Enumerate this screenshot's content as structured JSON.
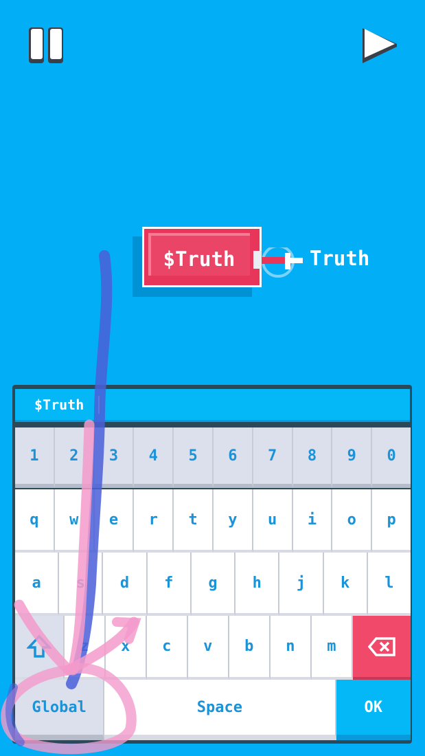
{
  "toolbar": {
    "pause_icon": "pause-icon",
    "play_icon": "play-icon"
  },
  "canvas": {
    "variable_block_label": "$Truth",
    "linked_label": "Truth"
  },
  "keyboard": {
    "input_value": "$Truth",
    "row_numbers": [
      "1",
      "2",
      "3",
      "4",
      "5",
      "6",
      "7",
      "8",
      "9",
      "0"
    ],
    "row_top": [
      "q",
      "w",
      "e",
      "r",
      "t",
      "y",
      "u",
      "i",
      "o",
      "p"
    ],
    "row_middle": [
      "a",
      "s",
      "d",
      "f",
      "g",
      "h",
      "j",
      "k",
      "l"
    ],
    "row_bottom": [
      "z",
      "x",
      "c",
      "v",
      "b",
      "n",
      "m"
    ],
    "shift_icon": "shift-arrow-icon",
    "backspace_icon": "backspace-icon",
    "global_label": "Global",
    "space_label": "Space",
    "ok_label": "OK"
  },
  "colors": {
    "background": "#02aef5",
    "block_red": "#e8365a",
    "key_blue": "#1b93d8",
    "annotation_blue": "#3f5fd4",
    "annotation_pink": "#f39acb"
  }
}
